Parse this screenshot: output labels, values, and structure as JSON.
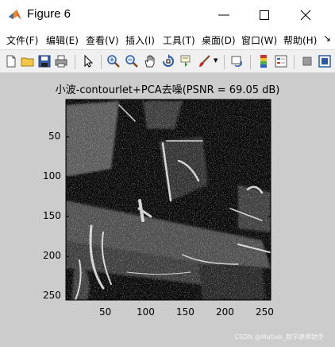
{
  "window": {
    "title": "Figure 6",
    "icon": "matlab-logo-icon",
    "controls": [
      "minimize-icon",
      "maximize-icon",
      "close-icon"
    ]
  },
  "menu": {
    "items": [
      {
        "label": "文件(F)"
      },
      {
        "label": "编辑(E)"
      },
      {
        "label": "查看(V)"
      },
      {
        "label": "插入(I)"
      },
      {
        "label": "工具(T)"
      },
      {
        "label": "桌面(D)"
      },
      {
        "label": "窗口(W)"
      },
      {
        "label": "帮助(H)"
      }
    ],
    "overflow": "↘"
  },
  "toolbar": {
    "buttons": [
      "new-figure-icon",
      "open-file-icon",
      "save-icon",
      "print-icon",
      "pointer-icon",
      "zoom-in-icon",
      "zoom-out-icon",
      "pan-icon",
      "rotate-3d-icon",
      "data-cursor-icon",
      "brush-icon",
      "link-plot-icon",
      "colorbar-icon",
      "legend-icon",
      "hide-plot-tools-icon",
      "show-plot-tools-icon"
    ]
  },
  "plot": {
    "title": "小波-contourlet+PCA去噪(PSNR = 69.05 dB)",
    "image_size": [
      256,
      256
    ],
    "colormap": "gray",
    "x_ticks": [
      "50",
      "100",
      "150",
      "200",
      "250"
    ],
    "y_ticks": [
      "50",
      "100",
      "150",
      "200",
      "250"
    ]
  },
  "watermark": "CSDN @Matlab_数学建模助手",
  "colors": {
    "figure_bg": "#cccccc",
    "toolbar_bg": "#f0f0f0",
    "image_bg": "#0a0a0a"
  }
}
